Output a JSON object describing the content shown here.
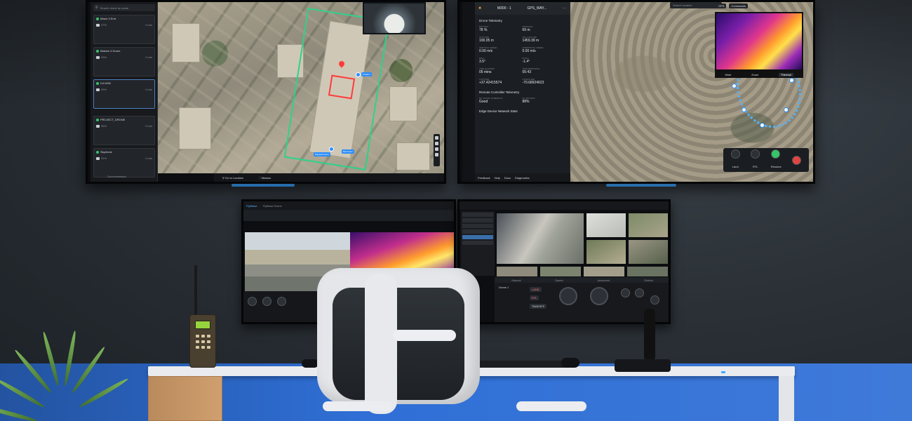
{
  "left_screen": {
    "search_placeholder": "Search drone by name",
    "drones": [
      {
        "name": "Mavic 3 Enrt",
        "battery": "97%",
        "speed": "0 m/s"
      },
      {
        "name": "Matrice 4 Drone",
        "battery": "93%",
        "speed": "0 m/s"
      },
      {
        "name": "DJI M30",
        "battery": "99%",
        "speed": "0 m/s"
      },
      {
        "name": "PROJECT_DRONE",
        "battery": "95%",
        "speed": "0 m/s"
      },
      {
        "name": "Skydrone",
        "battery": "91%",
        "speed": "0 m/s"
      }
    ],
    "map_labels": {
      "tag_1": "Position",
      "tag_2": "Mapped Drone",
      "tag_3": "Bell Tower"
    },
    "bottom_bar": {
      "goto": "Go to Location",
      "mission": "Mission"
    },
    "documentation": "Documentation"
  },
  "right_screen": {
    "drone_title": "M300 - 1",
    "gps_status": "GPS_WAY...",
    "telemetry_title": "Drone Telemetry",
    "telemetry": [
      {
        "label": "BATTERY",
        "value": "78 %"
      },
      {
        "label": "DISTANCE",
        "value": "69 m"
      },
      {
        "label": "ALTITUDE",
        "value": "100.05 m"
      },
      {
        "label": "ASL ALTITUDE",
        "value": "1459.39 m"
      },
      {
        "label": "VERTICAL SPEED",
        "value": "0.00 m/s"
      },
      {
        "label": "HORIZONTAL SPEED",
        "value": "0.00 m/s"
      },
      {
        "label": "ROLL",
        "value": "3.5°"
      },
      {
        "label": "PITCH",
        "value": "-1.4°"
      },
      {
        "label": "TIME ELAPSED",
        "value": "05 mins"
      },
      {
        "label": "TIME REMAINING",
        "value": "05:43"
      },
      {
        "label": "LATITUDE",
        "value": "+37.42415574"
      },
      {
        "label": "LONGITUDE",
        "value": "-70.68924623"
      }
    ],
    "rc_title": "Remote Controller Telemetry",
    "rc": [
      {
        "label": "RC SIGNAL STRENGTH",
        "value": "Good"
      },
      {
        "label": "RC BATTERY",
        "value": "88%"
      }
    ],
    "edge_title": "Edge Device Network Stats",
    "footer": {
      "feedback": "Feedback",
      "help": "Help",
      "docs": "Docs",
      "diagnostics": "Diagnostics"
    },
    "search_placeholder": "Search location",
    "camera_tabs": {
      "wide": "Wide",
      "zoom": "Zoom",
      "thermal": "Thermal"
    },
    "top_chips": {
      "gps": "GPS",
      "commands": "Commands"
    },
    "action_labels": {
      "land": "Land",
      "rtl": "RTL",
      "resume": "Resume"
    }
  },
  "lower_left": {
    "app_name": "FlytBase",
    "tab": "Flytbase Drone"
  },
  "lower_right": {
    "panels": {
      "manual": "Manual",
      "advanced": "Advanced",
      "speed": "Speed",
      "gimbal": "Gimbal"
    },
    "drone_label": "Drone 1",
    "buttons": {
      "land": "LAND",
      "rtl": "RTL",
      "takeoff": "TAKEOFF"
    }
  },
  "colors": {
    "accent": "#2b8cff",
    "geofence": "#2fd18a",
    "alert": "#ff3b3b",
    "desk_floor": "#2f6fd6"
  }
}
